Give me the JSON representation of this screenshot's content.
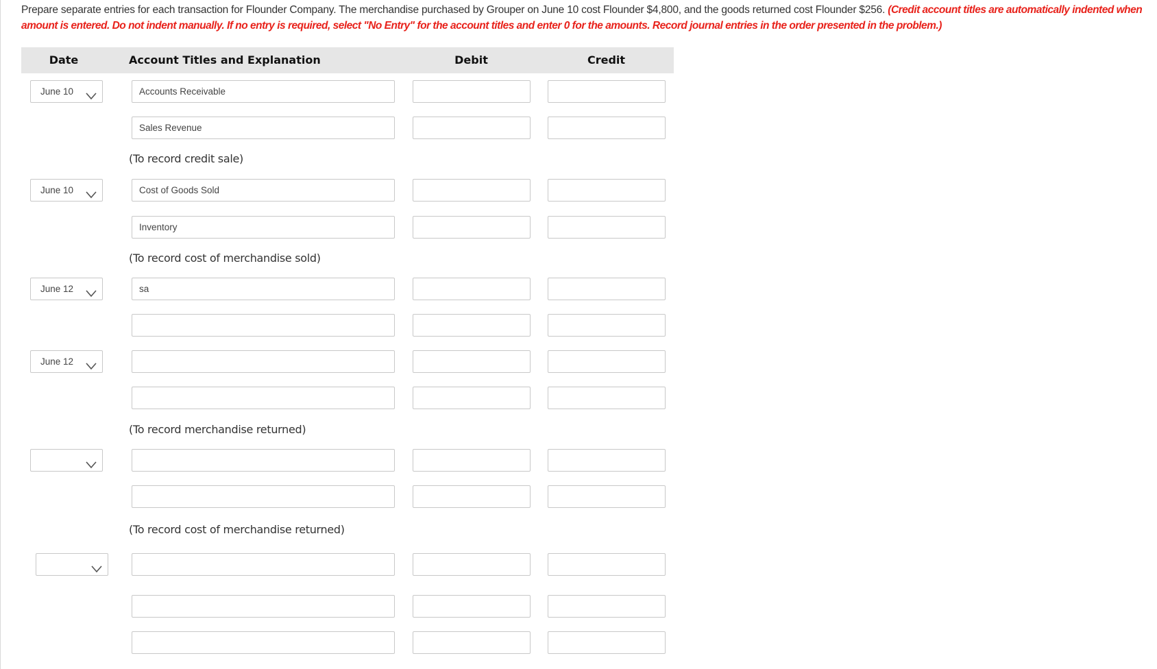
{
  "instructions": {
    "text": "Prepare separate entries for each transaction for Flounder Company. The merchandise purchased by Grouper on June 10 cost Flounder $4,800, and the goods returned cost Flounder $256.",
    "note": "(Credit account titles are automatically indented when amount is entered. Do not indent manually. If no entry is required, select \"No Entry\" for the account titles and enter 0 for the amounts. Record journal entries in the order presented in the problem.)",
    "note_color": "#e8221b"
  },
  "table": {
    "headers": {
      "date": "Date",
      "account": "Account Titles and Explanation",
      "debit": "Debit",
      "credit": "Credit"
    },
    "entries": [
      {
        "date": "June 10",
        "lines": [
          {
            "account": "Accounts Receivable",
            "debit": "",
            "credit": ""
          },
          {
            "account": "Sales Revenue",
            "debit": "",
            "credit": ""
          }
        ],
        "explanation": "(To record credit sale)"
      },
      {
        "date": "June 10",
        "lines": [
          {
            "account": "Cost of Goods Sold",
            "debit": "",
            "credit": ""
          },
          {
            "account": "Inventory",
            "debit": "",
            "credit": ""
          }
        ],
        "explanation": "(To record cost of merchandise sold)"
      },
      {
        "date": "June 12",
        "lines": [
          {
            "account": "sa",
            "debit": "",
            "credit": ""
          },
          {
            "account": "",
            "debit": "",
            "credit": ""
          }
        ],
        "explanation": ""
      },
      {
        "date": "June 12",
        "lines": [
          {
            "account": "",
            "debit": "",
            "credit": ""
          },
          {
            "account": "",
            "debit": "",
            "credit": ""
          }
        ],
        "explanation": "(To record merchandise returned)"
      },
      {
        "date": "",
        "lines": [
          {
            "account": "",
            "debit": "",
            "credit": ""
          },
          {
            "account": "",
            "debit": "",
            "credit": ""
          }
        ],
        "explanation": "(To record cost of merchandise returned)"
      },
      {
        "date": "",
        "lines": [
          {
            "account": "",
            "debit": "",
            "credit": ""
          },
          {
            "account": "",
            "debit": "",
            "credit": ""
          },
          {
            "account": "",
            "debit": "",
            "credit": ""
          }
        ],
        "explanation": ""
      }
    ]
  }
}
